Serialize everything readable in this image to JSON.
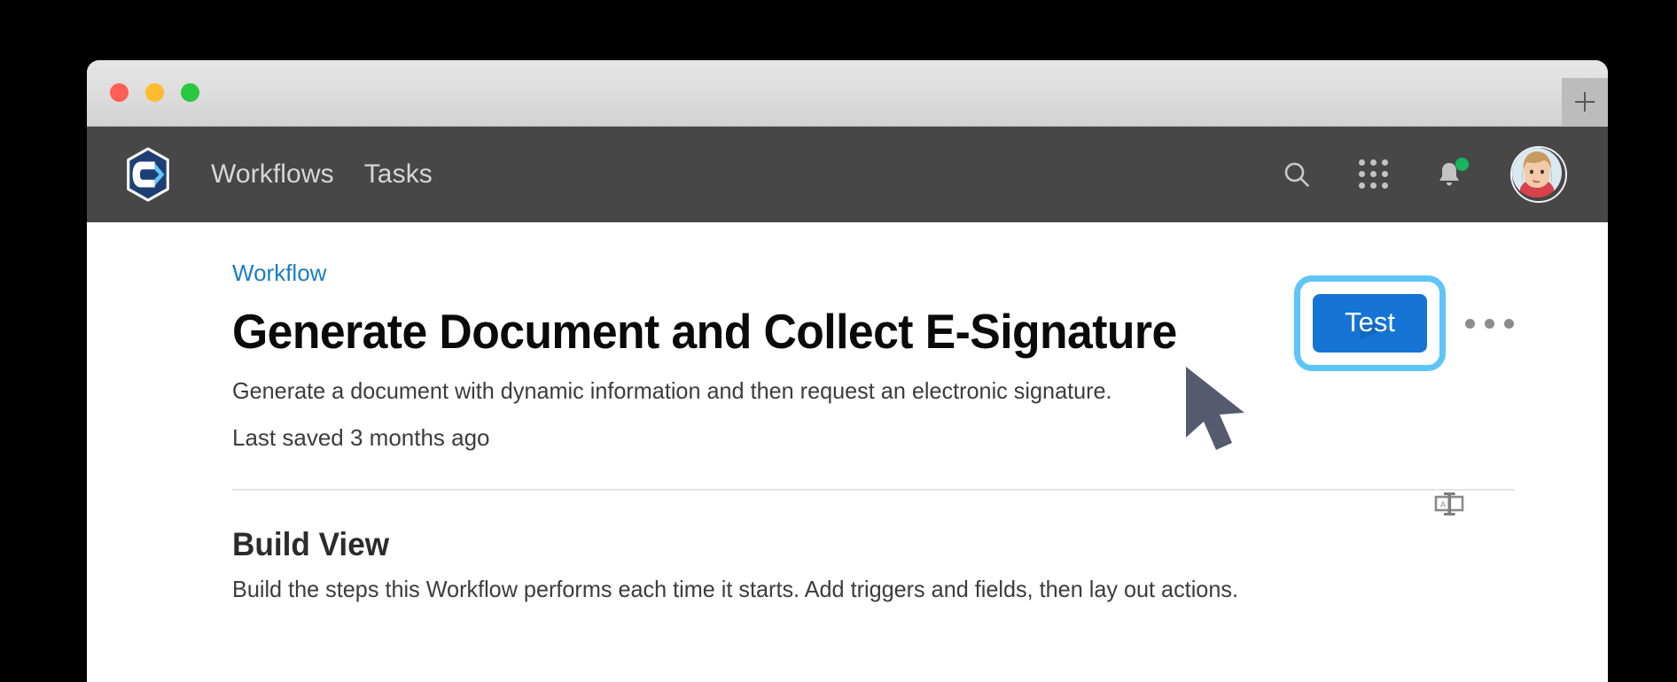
{
  "window": {
    "traffic_lights": [
      {
        "name": "close",
        "color": "#ff5f57"
      },
      {
        "name": "minimize",
        "color": "#febc2e"
      },
      {
        "name": "maximize",
        "color": "#28c840"
      }
    ],
    "new_tab_label": "+"
  },
  "navbar": {
    "logo_name": "company-hexagon-logo",
    "background": "#474747",
    "links": [
      {
        "label": "Workflows"
      },
      {
        "label": "Tasks"
      }
    ],
    "icons": [
      {
        "name": "search-icon"
      },
      {
        "name": "apps-grid-icon"
      },
      {
        "name": "notifications-bell-icon",
        "badge": true,
        "badge_color": "#15b75e"
      }
    ],
    "avatar_name": "user-avatar"
  },
  "page": {
    "breadcrumb": "Workflow",
    "breadcrumb_color": "#1a7ec1",
    "title": "Generate Document and Collect E-Signature",
    "description": "Generate a document with dynamic information and then request an electronic signature.",
    "last_saved": "Last saved 3 months ago"
  },
  "actions": {
    "test_label": "Test",
    "test_color": "#1574d4",
    "highlight_color": "#5dc5f7",
    "more_menu_name": "more-options-kebab",
    "rename_icon_name": "rename-text-field-icon"
  },
  "section": {
    "title": "Build View",
    "description": "Build the steps this Workflow performs each time it starts. Add triggers and fields, then lay out actions."
  }
}
